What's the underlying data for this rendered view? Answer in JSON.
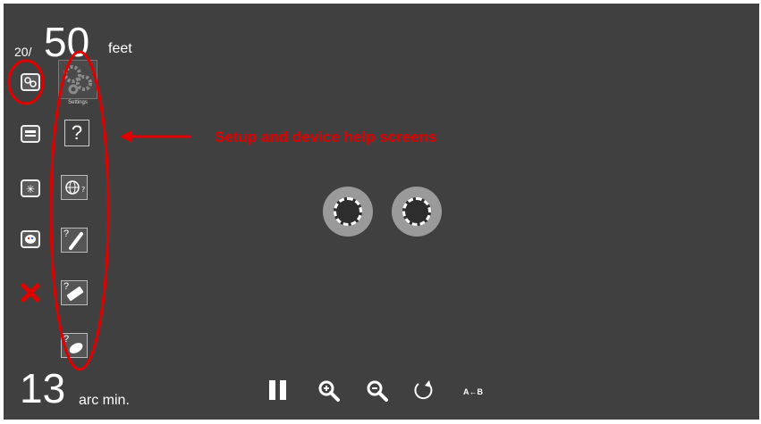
{
  "acuity": {
    "prefix": "20/",
    "value": "50",
    "unit": "feet"
  },
  "settings_tile": {
    "label": "Settings"
  },
  "help_question_mark": "?",
  "annotation": {
    "text": "Setup and device help screens",
    "color": "#e00000"
  },
  "bottom": {
    "value": "13",
    "unit": "arc min."
  },
  "controls": {
    "swap_label": "A←B"
  },
  "colors": {
    "background": "#404040",
    "annotation": "#e00000",
    "target_disc": "#9a9a9a"
  }
}
